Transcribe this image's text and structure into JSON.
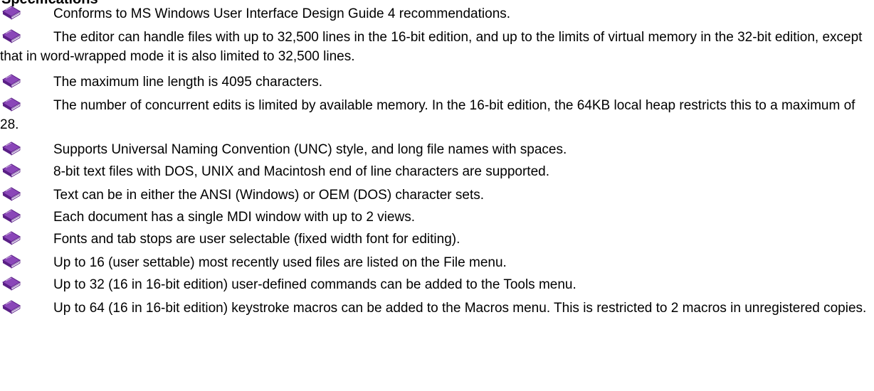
{
  "heading": "Specifications",
  "bullet_icon": "purple-book-icon",
  "colors": {
    "bullet_cover": "#8a46b8",
    "bullet_spine": "#5a1f86",
    "bullet_pages": "#f2eefa",
    "text": "#000000"
  },
  "features": [
    {
      "text": "Conforms to MS Windows User Interface Design Guide 4 recommendations."
    },
    {
      "text": "The editor can handle files with up to 32,500 lines in the 16-bit edition, and up to the limits of virtual memory in the 32-bit edition, except that in word-wrapped mode it is also limited to 32,500 lines."
    },
    {
      "text": "The maximum line length is 4095 characters."
    },
    {
      "text": "The number of concurrent edits is limited by available memory.   In the 16-bit edition, the 64KB local heap restricts this to a maximum of 28."
    },
    {
      "text": "Supports Universal Naming Convention (UNC) style, and long file names with spaces."
    },
    {
      "text": "8-bit text files with DOS, UNIX and Macintosh end of line characters are supported."
    },
    {
      "text": "Text can be in either the ANSI (Windows) or OEM (DOS) character sets."
    },
    {
      "text": "Each document has a single MDI window with up to 2 views."
    },
    {
      "text": "Fonts and tab stops are user selectable (fixed width font for editing)."
    },
    {
      "text": "Up to 16 (user settable) most recently used files are listed on the File menu."
    },
    {
      "text": "Up to 32 (16 in 16-bit edition) user-defined commands can be added to the Tools menu."
    },
    {
      "text": "Up to 64 (16 in 16-bit edition) keystroke macros can be added to the Macros menu. This is restricted to 2 macros in unregistered copies."
    }
  ]
}
